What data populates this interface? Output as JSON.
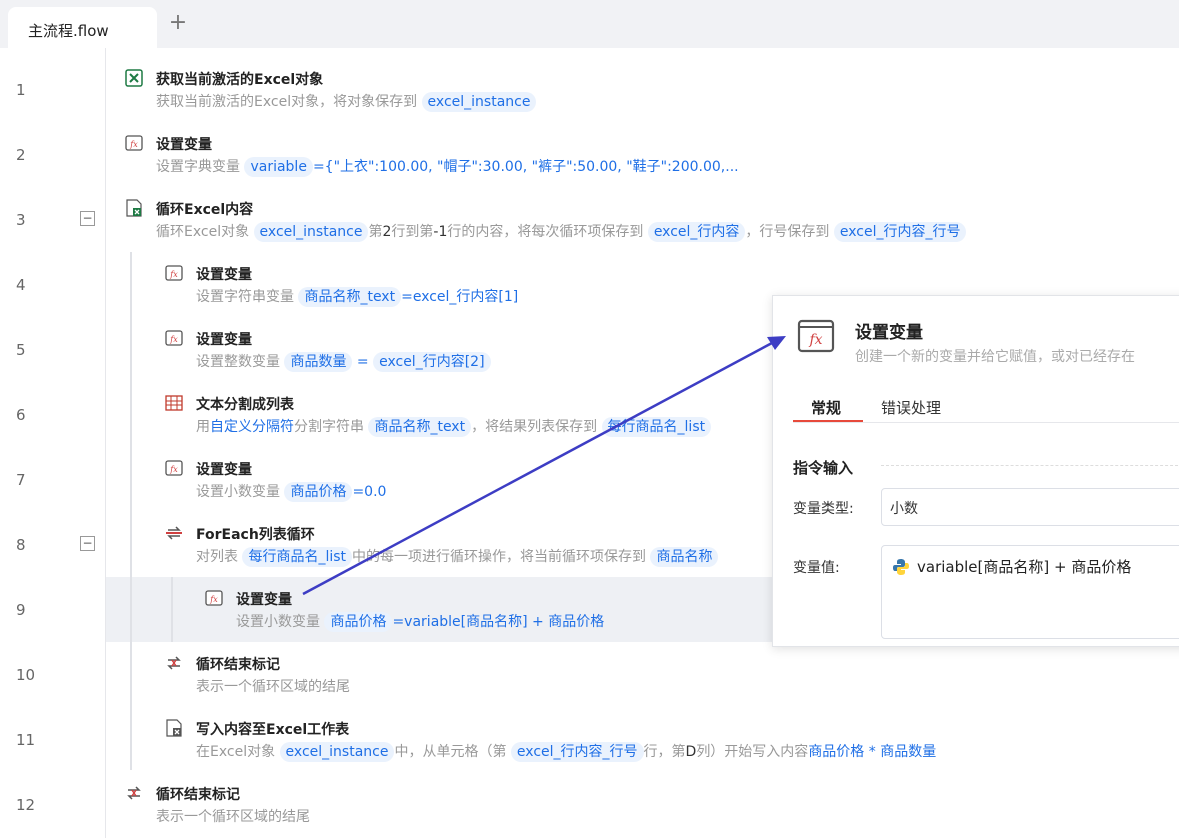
{
  "tabs": {
    "active_label": "主流程.flow",
    "add_symbol": "+"
  },
  "line_numbers": [
    "1",
    "2",
    "3",
    "4",
    "5",
    "6",
    "7",
    "8",
    "9",
    "10",
    "11",
    "12"
  ],
  "collapse_symbol": "−",
  "steps": {
    "s1": {
      "title": "获取当前激活的Excel对象",
      "desc_prefix": "获取当前激活的Excel对象，将对象保存到",
      "var1": "excel_instance"
    },
    "s2": {
      "title": "设置变量",
      "desc_prefix": "设置字典变量",
      "var1": "variable",
      "value": "={\"上衣\":100.00, \"帽子\":30.00, \"裤子\":50.00, \"鞋子\":200.00,..."
    },
    "s3": {
      "title": "循环Excel内容",
      "desc_a": "循环Excel对象",
      "var1": "excel_instance",
      "desc_b1": "第",
      "row_from": "2",
      "desc_b2": "行到第",
      "row_to": "-1",
      "desc_b3": "行的内容，将每次循环项保存到",
      "var2": "excel_行内容",
      "desc_c": "，行号保存到",
      "var3": "excel_行内容_行号"
    },
    "s4": {
      "title": "设置变量",
      "desc_prefix": "设置字符串变量",
      "var1": "商品名称_text",
      "value": "=excel_行内容[1]"
    },
    "s5": {
      "title": "设置变量",
      "desc_prefix": "设置整数变量",
      "var1": "商品数量",
      "eq": "=",
      "var2": "excel_行内容[2]"
    },
    "s6": {
      "title": "文本分割成列表",
      "desc_a": "用",
      "link": "自定义分隔符",
      "desc_b": "分割字符串",
      "var1": "商品名称_text",
      "desc_c": "，将结果列表保存到",
      "var2": "每行商品名_list"
    },
    "s7": {
      "title": "设置变量",
      "desc_prefix": "设置小数变量",
      "var1": "商品价格",
      "value": "=0.0"
    },
    "s8": {
      "title": "ForEach列表循环",
      "desc_a": "对列表",
      "var1": "每行商品名_list",
      "desc_b": "中的每一项进行循环操作，将当前循环项保存到",
      "var2": "商品名称"
    },
    "s9": {
      "title": "设置变量",
      "desc_prefix": "设置小数变量",
      "var1": "商品价格",
      "value": "=variable[商品名称] + 商品价格"
    },
    "s10": {
      "title": "循环结束标记",
      "desc": "表示一个循环区域的结尾"
    },
    "s11": {
      "title": "写入内容至Excel工作表",
      "desc_a": "在Excel对象",
      "var1": "excel_instance",
      "desc_b": "中，从单元格（第",
      "var2": "excel_行内容_行号",
      "desc_c": "行，第",
      "col": "D",
      "desc_d": "列）开始写入内容",
      "value": "商品价格 * 商品数量"
    },
    "s12": {
      "title": "循环结束标记",
      "desc": "表示一个循环区域的结尾"
    }
  },
  "panel": {
    "title": "设置变量",
    "desc": "创建一个新的变量并给它赋值，或对已经存在",
    "tab_general": "常规",
    "tab_error": "错误处理",
    "section_input": "指令输入",
    "type_label": "变量类型:",
    "type_value": "小数",
    "value_label": "变量值:",
    "value_expr": "variable[商品名称] + 商品价格"
  },
  "colors": {
    "accent_blue": "#1f6fe6",
    "var_bg": "#eaf2fd",
    "active_tab_red": "#e74a3b",
    "arrow": "#3d3dc4",
    "excel_green": "#1e7a44"
  },
  "icons": [
    "excel-icon",
    "fx-icon",
    "loop-excel-icon",
    "split-text-icon",
    "foreach-icon",
    "loop-end-icon",
    "write-excel-icon",
    "python-icon",
    "add-icon"
  ]
}
